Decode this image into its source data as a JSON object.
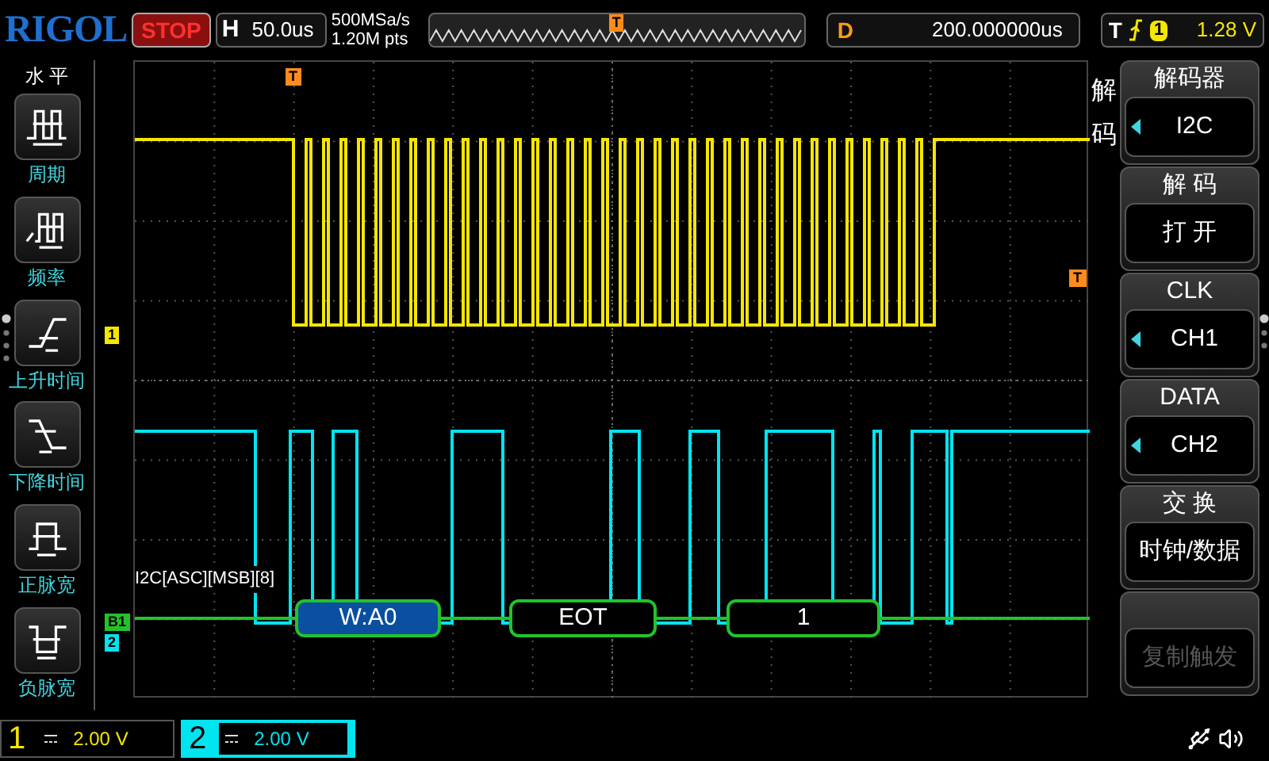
{
  "brand": "RIGOL",
  "run_state": "STOP",
  "timebase": {
    "label": "H",
    "value": "50.0us"
  },
  "acquisition": {
    "sample_rate": "500MSa/s",
    "memory_depth": "1.20M pts"
  },
  "overview": {
    "trigger_marker": "T"
  },
  "delay": {
    "label": "D",
    "value": "200.000000us"
  },
  "trigger": {
    "label": "T",
    "source": "1",
    "level": "1.28 V"
  },
  "left_menu": {
    "title": "水 平",
    "items": [
      {
        "label": "周期",
        "kind": "period"
      },
      {
        "label": "频率",
        "kind": "frequency"
      },
      {
        "label": "上升时间",
        "kind": "rise"
      },
      {
        "label": "下降时间",
        "kind": "fall"
      },
      {
        "label": "正脉宽",
        "kind": "pos_width"
      },
      {
        "label": "负脉宽",
        "kind": "neg_width"
      }
    ]
  },
  "screen": {
    "trigger_position_marker": "T",
    "trigger_level_marker": "T",
    "channel_markers": [
      {
        "label": "1",
        "color": "#f5e600"
      },
      {
        "label": "B1",
        "color": "#22c32a"
      },
      {
        "label": "2",
        "color": "#00e5f0"
      }
    ],
    "decode": {
      "label": "I2C[ASC][MSB][8]",
      "packets": [
        {
          "text": "W:A0",
          "kind": "address"
        },
        {
          "text": "EOT",
          "kind": "data"
        },
        {
          "text": "1",
          "kind": "data"
        }
      ]
    }
  },
  "right_menu": {
    "title": "解码",
    "softkeys": [
      {
        "title": "解码器",
        "value": "I2C",
        "arrow": true,
        "disabled": false
      },
      {
        "title": "解 码",
        "value": "打 开",
        "arrow": false,
        "disabled": false
      },
      {
        "title": "CLK",
        "value": "CH1",
        "arrow": true,
        "disabled": false
      },
      {
        "title": "DATA",
        "value": "CH2",
        "arrow": true,
        "disabled": false
      },
      {
        "title": "交 换",
        "value": "时钟/数据",
        "arrow": false,
        "disabled": false
      },
      {
        "value": "复制触发",
        "arrow": false,
        "disabled": true
      }
    ]
  },
  "channels": [
    {
      "number": "1",
      "scale": "2.00 V",
      "selected": false
    },
    {
      "number": "2",
      "scale": "2.00 V",
      "selected": true
    }
  ]
}
